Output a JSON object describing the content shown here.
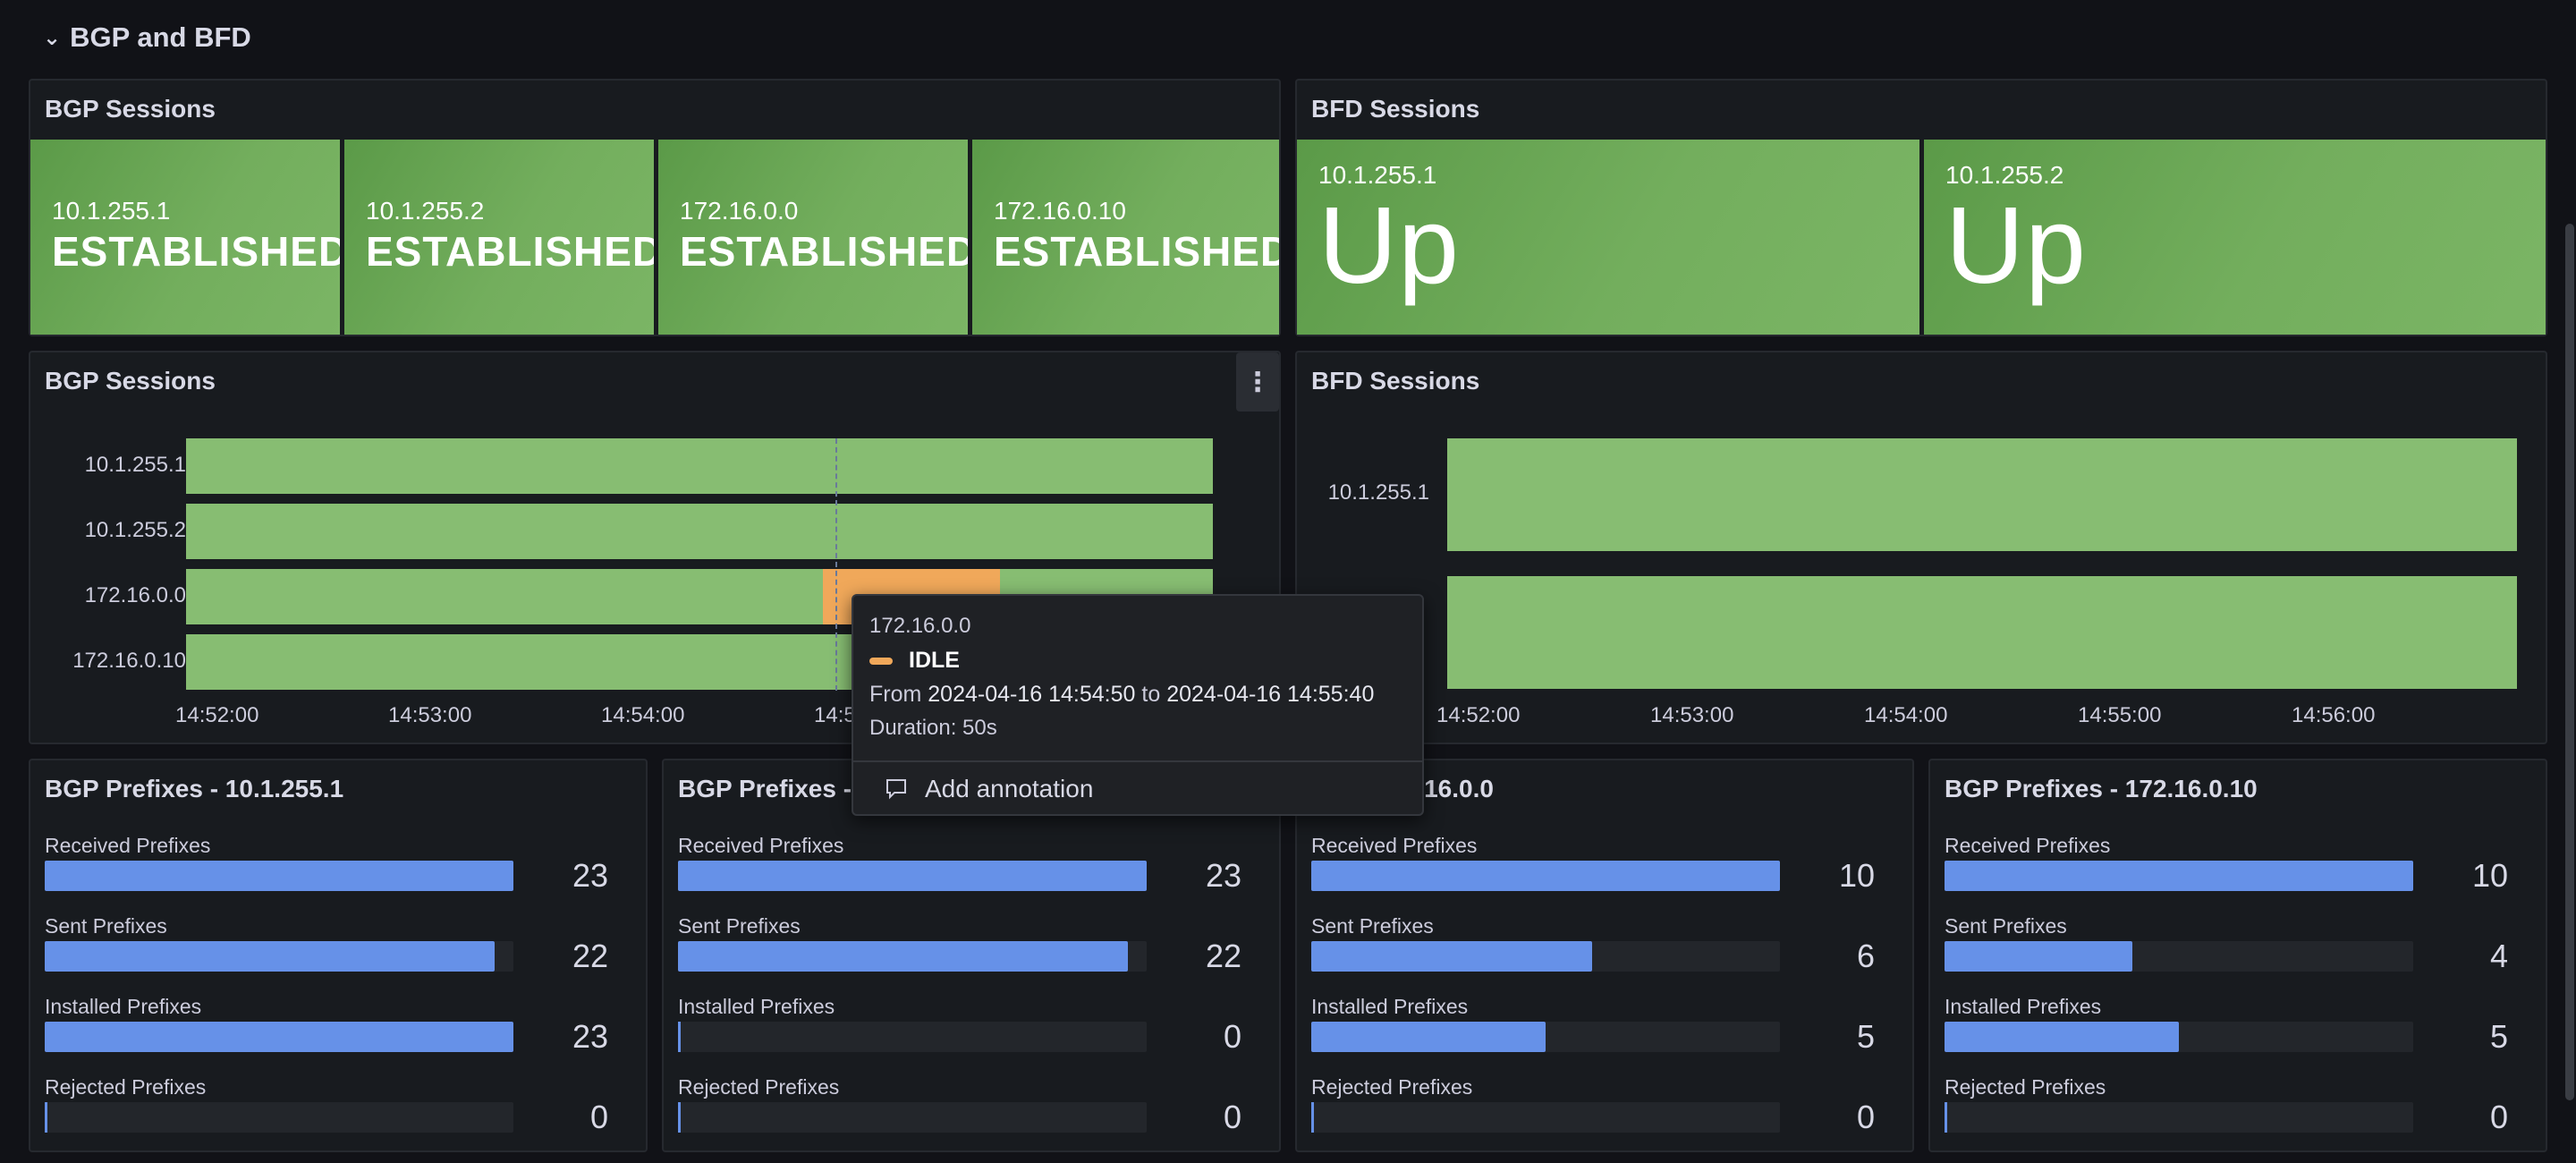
{
  "row": {
    "chevron": "⌄",
    "title": "BGP and BFD"
  },
  "bgp_stat": {
    "title": "BGP Sessions",
    "tiles": [
      {
        "name": "10.1.255.1",
        "value": "ESTABLISHED"
      },
      {
        "name": "10.1.255.2",
        "value": "ESTABLISHED"
      },
      {
        "name": "172.16.0.0",
        "value": "ESTABLISHED"
      },
      {
        "name": "172.16.0.10",
        "value": "ESTABLISHED"
      }
    ]
  },
  "bfd_stat": {
    "title": "BFD Sessions",
    "tiles": [
      {
        "name": "10.1.255.1",
        "value": "Up"
      },
      {
        "name": "10.1.255.2",
        "value": "Up"
      }
    ]
  },
  "bgp_timeline": {
    "title": "BGP Sessions",
    "menu_icon": "⋮",
    "rows": [
      "10.1.255.1",
      "10.1.255.2",
      "172.16.0.0",
      "172.16.0.10"
    ],
    "ticks": [
      "14:52:00",
      "14:53:00",
      "14:54:00",
      "14:5"
    ]
  },
  "bfd_timeline": {
    "title": "BFD Sessions",
    "rows": [
      "10.1.255.1"
    ],
    "ticks": [
      "14:52:00",
      "14:53:00",
      "14:54:00",
      "14:55:00",
      "14:56:00"
    ]
  },
  "tooltip": {
    "series": "172.16.0.0",
    "state": "IDLE",
    "from_label": "From",
    "from": "2024-04-16 14:54:50",
    "to_label": "to",
    "to": "2024-04-16 14:55:40",
    "duration": "Duration: 50s",
    "add_annotation": "Add annotation"
  },
  "prefix_panels": [
    {
      "title": "BGP Prefixes - 10.1.255.1",
      "gauges": [
        {
          "label": "Received Prefixes",
          "value": "23",
          "fraction": 1.0
        },
        {
          "label": "Sent Prefixes",
          "value": "22",
          "fraction": 0.96
        },
        {
          "label": "Installed Prefixes",
          "value": "23",
          "fraction": 1.0
        },
        {
          "label": "Rejected Prefixes",
          "value": "0",
          "fraction": 0
        }
      ]
    },
    {
      "title": "BGP Prefixes -",
      "gauges": [
        {
          "label": "Received Prefixes",
          "value": "23",
          "fraction": 1.0
        },
        {
          "label": "Sent Prefixes",
          "value": "22",
          "fraction": 0.96
        },
        {
          "label": "Installed Prefixes",
          "value": "0",
          "fraction": 0
        },
        {
          "label": "Rejected Prefixes",
          "value": "0",
          "fraction": 0
        }
      ]
    },
    {
      "title": "xes - 172.16.0.0",
      "gauges": [
        {
          "label": "Received Prefixes",
          "value": "10",
          "fraction": 1.0
        },
        {
          "label": "Sent Prefixes",
          "value": "6",
          "fraction": 0.6
        },
        {
          "label": "Installed Prefixes",
          "value": "5",
          "fraction": 0.5
        },
        {
          "label": "Rejected Prefixes",
          "value": "0",
          "fraction": 0
        }
      ]
    },
    {
      "title": "BGP Prefixes - 172.16.0.10",
      "gauges": [
        {
          "label": "Received Prefixes",
          "value": "10",
          "fraction": 1.0
        },
        {
          "label": "Sent Prefixes",
          "value": "4",
          "fraction": 0.4
        },
        {
          "label": "Installed Prefixes",
          "value": "5",
          "fraction": 0.5
        },
        {
          "label": "Rejected Prefixes",
          "value": "0",
          "fraction": 0
        }
      ]
    }
  ]
}
